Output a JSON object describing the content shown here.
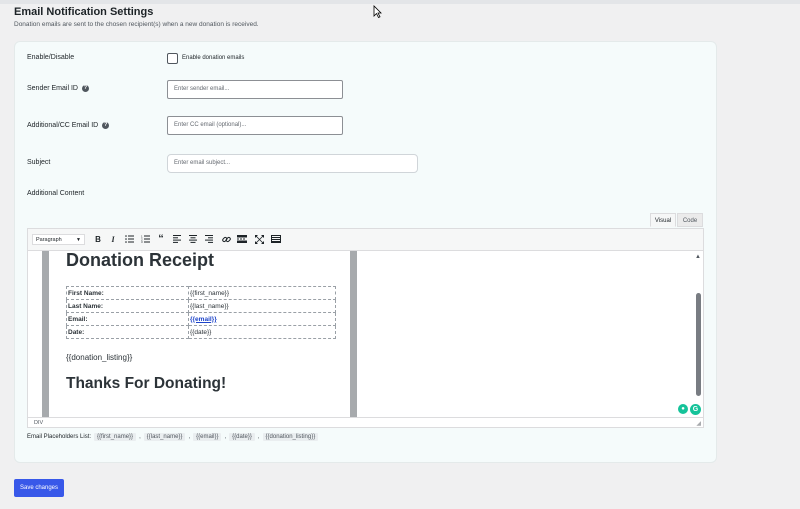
{
  "page": {
    "title": "Email Notification Settings",
    "description": "Donation emails are sent to the chosen recipient(s) when a new donation is received."
  },
  "form": {
    "enable_label": "Enable/Disable",
    "enable_checkbox_label": "Enable donation emails",
    "sender_label": "Sender Email ID",
    "sender_placeholder": "Enter sender email...",
    "cc_label": "Additional/CC Email ID",
    "cc_placeholder": "Enter CC email (optional)...",
    "subject_label": "Subject",
    "subject_placeholder": "Enter email subject...",
    "additional_content_label": "Additional Content"
  },
  "editor": {
    "tabs": {
      "visual": "Visual",
      "code": "Code"
    },
    "format_select": "Paragraph",
    "toolbar_icons": [
      "bold-icon",
      "italic-icon",
      "bullet-list-icon",
      "numbered-list-icon",
      "blockquote-icon",
      "align-left-icon",
      "align-center-icon",
      "align-right-icon",
      "link-icon",
      "read-more-icon",
      "fullscreen-icon",
      "toolbar-toggle-icon"
    ],
    "content": {
      "heading": "Donation Receipt",
      "rows": [
        {
          "key": "First Name:",
          "value": "{{first_name}}"
        },
        {
          "key": "Last Name:",
          "value": "{{last_name}}"
        },
        {
          "key": "Email:",
          "value": "{{email}}"
        },
        {
          "key": "Date:",
          "value": "{{date}}"
        }
      ],
      "donation_listing": "{{donation_listing}}",
      "thanks": "Thanks For Donating!"
    },
    "status_path": "DIV"
  },
  "placeholders": {
    "label": "Email Placeholders List:",
    "items": [
      "{{first_name}}",
      "{{last_name}}",
      "{{email}}",
      "{{date}}",
      "{{donation_listing}}"
    ],
    "separator": ","
  },
  "actions": {
    "save_label": "Save changes"
  },
  "colors": {
    "accent": "#3858e9",
    "link": "#1d44c9",
    "grammarly": "#15c39a"
  }
}
